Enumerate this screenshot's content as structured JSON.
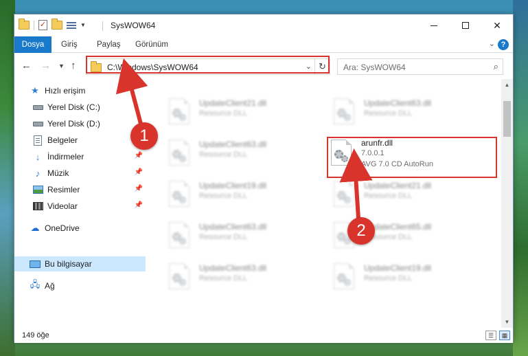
{
  "window": {
    "title": "SysWOW64"
  },
  "ribbon": {
    "tabs": [
      "Dosya",
      "Giriş",
      "Paylaş",
      "Görünüm"
    ],
    "active_tab": "Dosya",
    "help": "?"
  },
  "navigation": {
    "address": "C:\\Windows\\SysWOW64",
    "search_placeholder": "Ara: SysWOW64"
  },
  "sidebar": {
    "items": [
      {
        "label": "Hızlı erişim",
        "icon": "star-icon"
      },
      {
        "label": "Yerel Disk (C:)",
        "icon": "disk-icon"
      },
      {
        "label": "Yerel Disk (D:)",
        "icon": "disk-icon"
      },
      {
        "label": "Belgeler",
        "icon": "documents-icon"
      },
      {
        "label": "İndirmeler",
        "icon": "downloads-icon",
        "pinned": true
      },
      {
        "label": "Müzik",
        "icon": "music-icon",
        "pinned": true
      },
      {
        "label": "Resimler",
        "icon": "pictures-icon",
        "pinned": true
      },
      {
        "label": "Videolar",
        "icon": "videos-icon",
        "pinned": true
      },
      {
        "label": "OneDrive",
        "icon": "onedrive-icon"
      },
      {
        "label": "Bu bilgisayar",
        "icon": "computer-icon",
        "selected": true
      },
      {
        "label": "Ağ",
        "icon": "network-icon"
      }
    ]
  },
  "files": {
    "left_column": [
      {
        "name": "UpdateClient21.dll",
        "desc": "Resource DLL"
      },
      {
        "name": "UpdateClient63.dll",
        "desc": "Resource DLL"
      },
      {
        "name": "UpdateClient19.dll",
        "desc": "Resource DLL"
      },
      {
        "name": "UpdateClient63.dll",
        "desc": "Resource DLL"
      },
      {
        "name": "UpdateClient63.dll",
        "desc": "Resource DLL"
      }
    ],
    "right_column": [
      {
        "name": "UpdateClient63.dll",
        "desc": "Resource DLL"
      },
      {
        "name": "UpdateClient21.dll",
        "desc": "Resource DLL"
      },
      {
        "name": "UpdateClient65.dll",
        "desc": "Resource DLL"
      },
      {
        "name": "UpdateClient19.dll",
        "desc": "Resource DLL"
      }
    ],
    "target": {
      "name": "arunfr.dll",
      "version": "7.0.0.1",
      "desc": "AVG 7.0 CD AutoRun"
    }
  },
  "status": {
    "count": "149 öğe"
  },
  "annotations": {
    "step1": "1",
    "step2": "2",
    "color": "#d9342b"
  }
}
